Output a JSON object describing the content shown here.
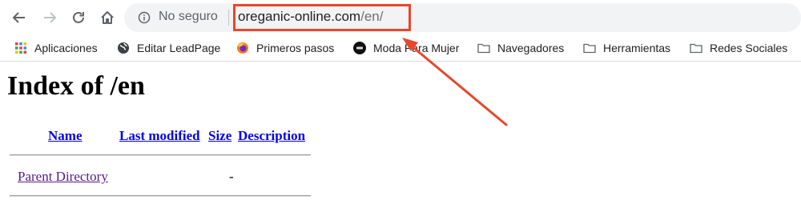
{
  "browser": {
    "security_label": "No seguro",
    "url_host": "oreganic-online.com",
    "url_path": "/en/",
    "colors": {
      "annotation": "#e8472c",
      "link": "#0000ee",
      "visited_link": "#551a8b"
    }
  },
  "bookmarks": [
    {
      "label": "Aplicaciones",
      "icon": "apps-grid-icon"
    },
    {
      "label": "Editar LeadPage",
      "icon": "globe-icon"
    },
    {
      "label": "Primeros pasos",
      "icon": "firefox-icon"
    },
    {
      "label": "Moda Para Mujer",
      "icon": "dft-icon"
    },
    {
      "label": "Navegadores",
      "icon": "folder-icon"
    },
    {
      "label": "Herramientas",
      "icon": "folder-icon"
    },
    {
      "label": "Redes Sociales",
      "icon": "folder-icon"
    }
  ],
  "page": {
    "title": "Index of /en",
    "columns": [
      "Name",
      "Last modified",
      "Size",
      "Description"
    ],
    "rows": [
      {
        "name": "Parent Directory",
        "last_modified": "",
        "size": "-",
        "description": ""
      }
    ]
  }
}
